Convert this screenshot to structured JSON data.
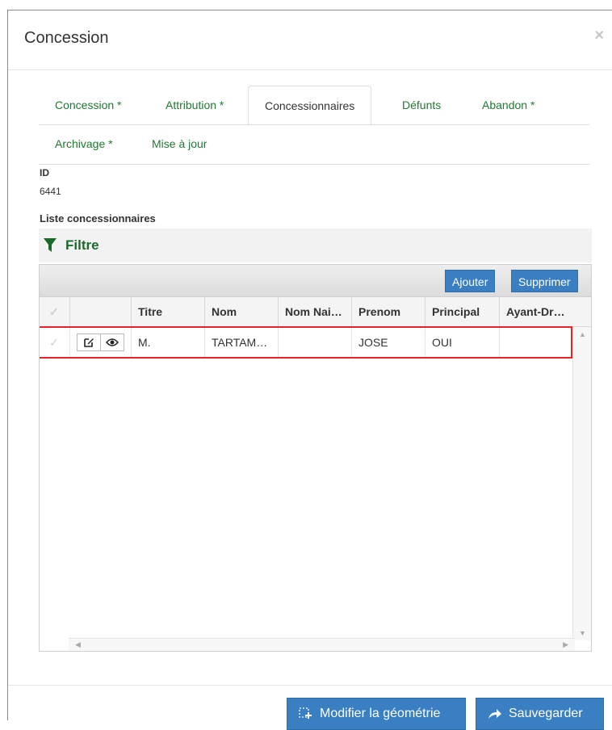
{
  "modal": {
    "title": "Concession",
    "close_label": "×"
  },
  "tabs": [
    {
      "label": "Concession *",
      "active": false
    },
    {
      "label": "Attribution *",
      "active": false
    },
    {
      "label": "Concessionnaires",
      "active": true
    },
    {
      "label": "Défunts",
      "active": false
    },
    {
      "label": "Abandon *",
      "active": false
    },
    {
      "label": "Archivage *",
      "active": false
    },
    {
      "label": "Mise à jour",
      "active": false
    }
  ],
  "id_field": {
    "label": "ID",
    "value": "6441"
  },
  "list": {
    "label": "Liste concessionnaires",
    "filter_label": "Filtre",
    "buttons": {
      "add": "Ajouter",
      "delete": "Supprimer"
    },
    "columns": [
      "Titre",
      "Nom",
      "Nom Nai…",
      "Prenom",
      "Principal",
      "Ayant-Dr…"
    ],
    "rows": [
      {
        "titre": "M.",
        "nom": "TARTAM…",
        "nom_naissance": "",
        "prenom": "JOSE",
        "principal": "OUI",
        "ayant_droit": ""
      }
    ]
  },
  "footer": {
    "modify_geometry": "Modifier la géométrie",
    "save": "Sauvegarder"
  },
  "colors": {
    "accent_blue": "#3a7fc1",
    "tab_green": "#1f7a32",
    "highlight_red": "#e8232a"
  }
}
